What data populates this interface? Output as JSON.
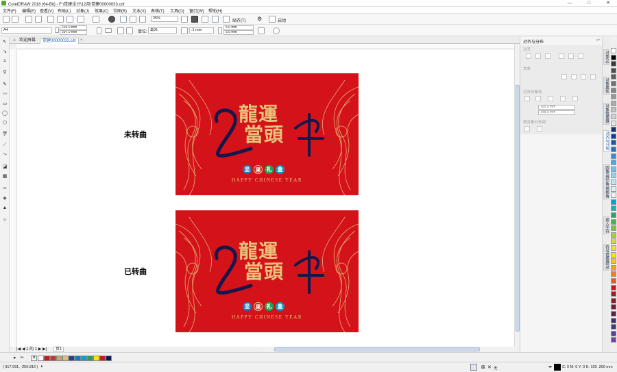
{
  "window": {
    "title": "CorelDRAW 2018 (64-Bit) - F:\\觉建设计\\12月\\觉建00000033.cdr",
    "controls": {
      "minimize": "—",
      "maximize": "□",
      "close": "✕"
    }
  },
  "menu": [
    "文件(F)",
    "编辑(E)",
    "查看(V)",
    "布局(L)",
    "对象(J)",
    "效果(C)",
    "位图(B)",
    "文本(X)",
    "表格(T)",
    "工具(O)",
    "窗口(W)",
    "帮助(H)"
  ],
  "toolbar1": {
    "zoom": "25%",
    "snap": "贴齐(T)",
    "launch": "启动"
  },
  "propertybar": {
    "page_size": "A4",
    "width": "210.0 mm",
    "height": "297.0 mm",
    "unit_label": "单位:",
    "unit": "毫米",
    "nudge": ".1 mm",
    "dup_x": "5.0 mm",
    "dup_y": "5.0 mm"
  },
  "tabs": [
    {
      "label": "欢迎屏幕"
    },
    {
      "label": "觉建00000033.cdr"
    },
    {
      "label": "+"
    }
  ],
  "canvas": {
    "labels": [
      "未转曲",
      "已转曲"
    ],
    "poster": {
      "title_line1": "龍運",
      "title_line2": "當頭",
      "gifts": [
        "坚",
        "果",
        "礼",
        "盒"
      ],
      "subtitle": "HAPPY CHINESE YEAR"
    }
  },
  "pagenav": {
    "first": "|◀",
    "prev": "◀",
    "current": "1",
    "of": "的",
    "total": "1",
    "next": "▶",
    "last": "▶|",
    "page_tab": "页1"
  },
  "status": {
    "coords": "( 917.091, -256.816 )",
    "arrow": "▸",
    "fill_label": "无",
    "outline": "C: 0 M: 0 Y: 0 K: 100  .200 mm"
  },
  "docker": {
    "title": "对齐与分布",
    "sections": [
      "对齐",
      "文本",
      "对齐对象到",
      "将对象分布到"
    ],
    "x_value": "105.0 mm",
    "y_value": "148.5 mm",
    "vtabs": [
      "对象(N)",
      "对象属性",
      "对象管理器",
      "对齐与分布",
      "圆角/扇形角/倒棱角",
      "插入字符",
      "符号管理器(D)"
    ]
  },
  "palette": {
    "swatches": [
      "#ffffff",
      "#d4121a",
      "#c7342a",
      "#c9a56a",
      "#e0bb7a",
      "#2d3b8e",
      "#0a7ec2",
      "#00a0e0",
      "#27a153",
      "#f7e400",
      "#c8152a",
      "#0f1a49"
    ],
    "docker_colors": [
      "#ffffff",
      "#000000",
      "#3a3a3a",
      "#4d4d4d",
      "#5f5f5f",
      "#727272",
      "#858585",
      "#989898",
      "#ababab",
      "#bfbfbf",
      "#d2d2d2",
      "#e6e6e6",
      "#1e2d6b",
      "#123f90",
      "#1a5aa8",
      "#2a72bf",
      "#3b8bd6",
      "#50a6e6",
      "#6cc0f0",
      "#8ed5f6",
      "#b9e6f9",
      "#d9f1fb",
      "#e9f6fc",
      "#00a2c8",
      "#17b1b7",
      "#27a56b",
      "#4bb04f",
      "#7dc242",
      "#a9cf38",
      "#cddc39",
      "#e8e336",
      "#f7e400",
      "#f9c31b",
      "#f6a11d",
      "#f0801f",
      "#e85b22",
      "#d4121a",
      "#b31524",
      "#8e1a30",
      "#6e1f3a",
      "#5a2348",
      "#482d66",
      "#3c3d85",
      "#5b3d9c",
      "#7a3fa6"
    ]
  }
}
